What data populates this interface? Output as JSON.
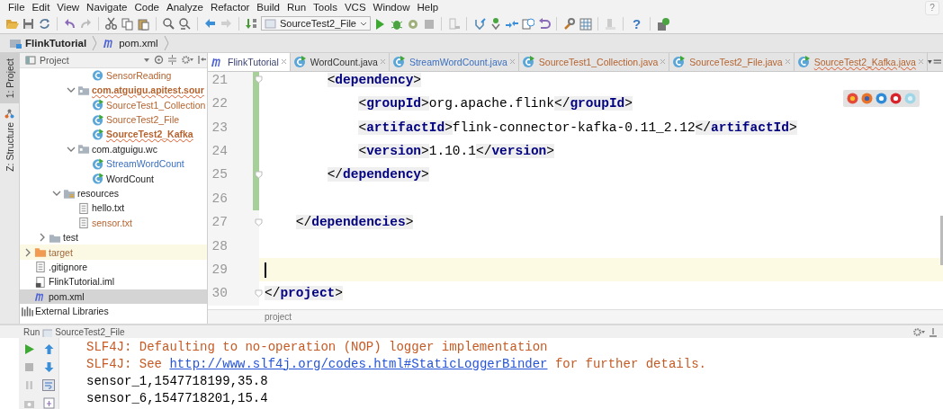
{
  "menu": [
    "File",
    "Edit",
    "View",
    "Navigate",
    "Code",
    "Analyze",
    "Refactor",
    "Build",
    "Run",
    "Tools",
    "VCS",
    "Window",
    "Help"
  ],
  "toolbar": {
    "run_config": "SourceTest2_File",
    "help_glyph": "?"
  },
  "corner_help": "?",
  "breadcrumb": [
    {
      "label": "FlinkTutorial",
      "kind": "module"
    },
    {
      "label": "pom.xml",
      "kind": "maven"
    }
  ],
  "side_tabs": [
    {
      "label": "1: Project",
      "selected": true
    },
    {
      "label": "Z: Structure",
      "selected": false
    }
  ],
  "project_panel": {
    "title": "Project",
    "tree": [
      {
        "children": [
          {
            "children": [
              {
                "children": [
                  {
                    "children": [
                      {
                        "children": [
                          {
                            "label": "SensorReading",
                            "kind": "class",
                            "color": "#b5632f",
                            "selected": false,
                            "bold": false,
                            "error": false,
                            "excluded": false
                          }
                        ]
                      },
                      {
                        "label": "com.atguigu.apitest.sour",
                        "kind": "package",
                        "color": "#b5632f",
                        "selected": false,
                        "bold": true,
                        "error": true,
                        "excluded": false,
                        "expanded": true,
                        "children": [
                          {
                            "label": "SourceTest1_Collection",
                            "kind": "runnable",
                            "color": "#b5632f",
                            "selected": false,
                            "bold": false,
                            "error": false,
                            "excluded": false
                          },
                          {
                            "label": "SourceTest2_File",
                            "kind": "runnable",
                            "color": "#b5632f",
                            "selected": false,
                            "bold": false,
                            "error": false,
                            "excluded": false
                          },
                          {
                            "label": "SourceTest2_Kafka",
                            "kind": "runnable",
                            "color": "#b5632f",
                            "selected": false,
                            "bold": true,
                            "error": true,
                            "excluded": false
                          }
                        ]
                      },
                      {
                        "label": "com.atguigu.wc",
                        "kind": "package",
                        "selected": false,
                        "bold": false,
                        "error": false,
                        "excluded": false,
                        "expanded": true,
                        "children": [
                          {
                            "label": "StreamWordCount",
                            "kind": "runnable",
                            "color": "#3a6fc0",
                            "selected": false,
                            "bold": false,
                            "error": false,
                            "excluded": false
                          },
                          {
                            "label": "WordCount",
                            "kind": "runnable",
                            "selected": false,
                            "bold": false,
                            "error": false,
                            "excluded": false
                          }
                        ]
                      }
                    ]
                  },
                  {
                    "label": "resources",
                    "kind": "resources",
                    "selected": false,
                    "bold": false,
                    "error": false,
                    "excluded": false,
                    "expanded": true,
                    "children": [
                      {
                        "label": "hello.txt",
                        "kind": "text",
                        "selected": false,
                        "bold": false,
                        "error": false,
                        "excluded": false
                      },
                      {
                        "label": "sensor.txt",
                        "kind": "text",
                        "color": "#b5632f",
                        "selected": false,
                        "bold": false,
                        "error": false,
                        "excluded": false
                      }
                    ]
                  }
                ]
              },
              {
                "label": "test",
                "kind": "folder",
                "selected": false,
                "bold": false,
                "error": false,
                "excluded": false,
                "expanded": false
              }
            ]
          },
          {
            "label": "target",
            "kind": "excluded_folder",
            "color": "#a0673a",
            "selected": false,
            "bold": false,
            "error": false,
            "excluded": true,
            "expanded": false
          },
          {
            "label": ".gitignore",
            "kind": "text",
            "selected": false,
            "bold": false,
            "error": false,
            "excluded": false
          },
          {
            "label": "FlinkTutorial.iml",
            "kind": "iml",
            "selected": false,
            "bold": false,
            "error": false,
            "excluded": false
          },
          {
            "label": "pom.xml",
            "kind": "maven",
            "selected": true,
            "bold": false,
            "error": false,
            "excluded": false
          }
        ]
      },
      {
        "label": "External Libraries",
        "kind": "library",
        "selected": false,
        "bold": false,
        "error": false,
        "excluded": false
      }
    ]
  },
  "editor_tabs": [
    {
      "label": "FlinkTutorial",
      "kind": "maven",
      "color": "#3b4370",
      "selected": true,
      "error": false
    },
    {
      "label": "WordCount.java",
      "kind": "runnable",
      "color": "#333333",
      "selected": false,
      "error": false
    },
    {
      "label": "StreamWordCount.java",
      "kind": "runnable",
      "color": "#3a6fc0",
      "selected": false,
      "error": false
    },
    {
      "label": "SourceTest1_Collection.java",
      "kind": "runnable",
      "color": "#b5632f",
      "selected": false,
      "error": false
    },
    {
      "label": "SourceTest2_File.java",
      "kind": "runnable",
      "color": "#b5632f",
      "selected": false,
      "error": false
    },
    {
      "label": "SourceTest2_Kafka.java",
      "kind": "runnable",
      "color": "#b5632f",
      "selected": false,
      "error": true
    }
  ],
  "editor": {
    "lines": [
      {
        "number": "21",
        "code": "        <dependency>",
        "changed": true,
        "fold": true,
        "current": false
      },
      {
        "number": "22",
        "code": "            <groupId>org.apache.flink</groupId>",
        "changed": true,
        "fold": false,
        "current": false
      },
      {
        "number": "23",
        "code": "            <artifactId>flink-connector-kafka-0.11_2.12</artifactId>",
        "changed": true,
        "fold": false,
        "current": false
      },
      {
        "number": "24",
        "code": "            <version>1.10.1</version>",
        "changed": true,
        "fold": false,
        "current": false
      },
      {
        "number": "25",
        "code": "        </dependency>",
        "changed": true,
        "fold": true,
        "current": false
      },
      {
        "number": "26",
        "changed": true,
        "fold": false,
        "current": false
      },
      {
        "number": "27",
        "code": "    </dependencies>",
        "changed": false,
        "fold": true,
        "current": false
      },
      {
        "number": "28",
        "changed": false,
        "fold": false,
        "current": false
      },
      {
        "number": "29",
        "changed": false,
        "fold": false,
        "current": true
      },
      {
        "number": "30",
        "code": "</project>",
        "changed": false,
        "fold": true,
        "current": false
      }
    ],
    "breadcrumb": "project"
  },
  "run_panel": {
    "label": "Run",
    "config": "SourceTest2_File",
    "console": [
      {
        "kind": "error",
        "segments": [
          {
            "text": "SLF4J: Defaulting to no-operation (NOP) logger implementation",
            "link": false
          }
        ]
      },
      {
        "kind": "error",
        "segments": [
          {
            "text": "SLF4J: See ",
            "link": false
          },
          {
            "text": "http://www.slf4j.org/codes.html#StaticLoggerBinder",
            "link": true
          },
          {
            "text": " for further details.",
            "link": false
          }
        ]
      },
      {
        "kind": "output",
        "segments": [
          {
            "text": "sensor_1,1547718199,35.8",
            "link": false
          }
        ]
      },
      {
        "kind": "output",
        "segments": [
          {
            "text": "sensor_6,1547718201,15.4",
            "link": false
          }
        ]
      }
    ]
  }
}
